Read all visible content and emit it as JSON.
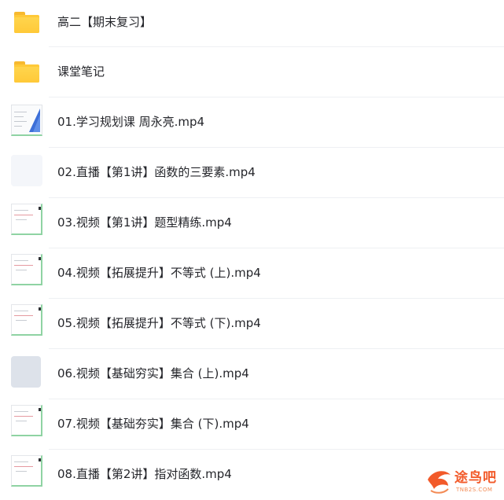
{
  "files": [
    {
      "name": "高二【期末复习】",
      "type": "folder",
      "icon": "folder-icon"
    },
    {
      "name": "课堂笔记",
      "type": "folder",
      "icon": "folder-icon"
    },
    {
      "name": "01.学习规划课 周永亮.mp4",
      "type": "video",
      "icon": "video-thumbnail"
    },
    {
      "name": "02.直播【第1讲】函数的三要素.mp4",
      "type": "video",
      "icon": "video-thumbnail"
    },
    {
      "name": "03.视频【第1讲】题型精练.mp4",
      "type": "video",
      "icon": "video-thumbnail"
    },
    {
      "name": "04.视频【拓展提升】不等式 (上).mp4",
      "type": "video",
      "icon": "video-thumbnail"
    },
    {
      "name": "05.视频【拓展提升】不等式 (下).mp4",
      "type": "video",
      "icon": "video-thumbnail"
    },
    {
      "name": "06.视频【基础穷实】集合 (上).mp4",
      "type": "video",
      "icon": "video-thumbnail"
    },
    {
      "name": "07.视频【基础夯实】集合 (下).mp4",
      "type": "video",
      "icon": "video-thumbnail"
    },
    {
      "name": "08.直播【第2讲】指对函数.mp4",
      "type": "video",
      "icon": "video-thumbnail"
    }
  ],
  "watermark": {
    "title": "途鸟吧",
    "url": "TNB2S.COM"
  },
  "colors": {
    "folder": "#ffc938",
    "divider": "#eef0f3",
    "text": "#25262b",
    "watermark": "#f25a2a"
  }
}
